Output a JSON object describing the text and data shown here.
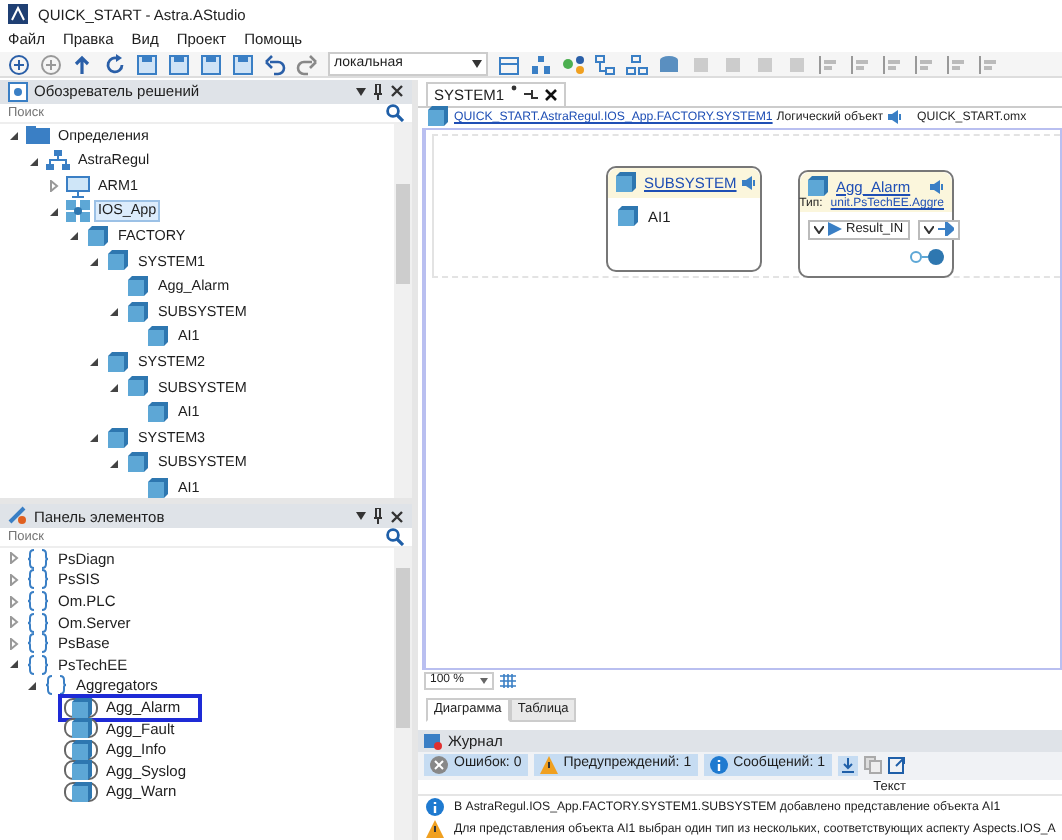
{
  "window": {
    "title": "QUICK_START - Astra.AStudio"
  },
  "menu": [
    "Файл",
    "Правка",
    "Вид",
    "Проект",
    "Помощь"
  ],
  "toolbar": {
    "dropdown": "локальная"
  },
  "solution_explorer": {
    "title": "Обозреватель решений",
    "placeholder": "Поиск",
    "tree": [
      {
        "label": "Определения",
        "kind": "folder",
        "expanded": true,
        "selected": false,
        "children": [
          {
            "label": "AstraRegul",
            "kind": "network",
            "expanded": true,
            "selected": false,
            "children": [
              {
                "label": "ARM1",
                "kind": "computer",
                "expanded": false,
                "selected": false
              },
              {
                "label": "IOS_App",
                "kind": "app",
                "expanded": true,
                "selected": true,
                "children": [
                  {
                    "label": "FACTORY",
                    "kind": "object",
                    "expanded": true,
                    "selected": false,
                    "children": [
                      {
                        "label": "SYSTEM1",
                        "kind": "object",
                        "expanded": true,
                        "selected": false,
                        "children": [
                          {
                            "label": "Agg_Alarm",
                            "kind": "object",
                            "selected": false
                          },
                          {
                            "label": "SUBSYSTEM",
                            "kind": "object",
                            "expanded": true,
                            "selected": false,
                            "children": [
                              {
                                "label": "AI1",
                                "kind": "object",
                                "selected": false
                              }
                            ]
                          }
                        ]
                      },
                      {
                        "label": "SYSTEM2",
                        "kind": "object",
                        "expanded": true,
                        "selected": false,
                        "children": [
                          {
                            "label": "SUBSYSTEM",
                            "kind": "object",
                            "expanded": true,
                            "selected": false,
                            "children": [
                              {
                                "label": "AI1",
                                "kind": "object",
                                "selected": false
                              }
                            ]
                          }
                        ]
                      },
                      {
                        "label": "SYSTEM3",
                        "kind": "object",
                        "expanded": true,
                        "selected": false,
                        "children": [
                          {
                            "label": "SUBSYSTEM",
                            "kind": "object",
                            "expanded": true,
                            "selected": false,
                            "children": [
                              {
                                "label": "AI1",
                                "kind": "object",
                                "selected": false
                              }
                            ]
                          }
                        ]
                      }
                    ]
                  }
                ]
              }
            ]
          }
        ]
      }
    ]
  },
  "toolbox": {
    "title": "Панель элементов",
    "placeholder": "Поиск",
    "tree": [
      {
        "label": "PsDiagn",
        "kind": "namespace",
        "expanded": false,
        "selected": false
      },
      {
        "label": "PsSIS",
        "kind": "namespace",
        "expanded": false,
        "selected": false
      },
      {
        "label": "Om.PLC",
        "kind": "namespace",
        "expanded": false,
        "selected": false
      },
      {
        "label": "Om.Server",
        "kind": "namespace",
        "expanded": false,
        "selected": false
      },
      {
        "label": "PsBase",
        "kind": "namespace",
        "expanded": false,
        "selected": false
      },
      {
        "label": "PsTechEE",
        "kind": "namespace",
        "expanded": true,
        "selected": false,
        "children": [
          {
            "label": "Aggregators",
            "kind": "namespace",
            "expanded": true,
            "selected": false,
            "children": [
              {
                "label": "Agg_Alarm",
                "kind": "type",
                "selected": true
              },
              {
                "label": "Agg_Fault",
                "kind": "type",
                "selected": false
              },
              {
                "label": "Agg_Info",
                "kind": "type",
                "selected": false
              },
              {
                "label": "Agg_Syslog",
                "kind": "type",
                "selected": false
              },
              {
                "label": "Agg_Warn",
                "kind": "type",
                "selected": false
              }
            ]
          }
        ]
      }
    ]
  },
  "editor": {
    "tab": {
      "label": "SYSTEM1",
      "modified": true
    },
    "breadcrumb": {
      "path": "QUICK_START.AstraRegul.IOS_App.FACTORY.SYSTEM1",
      "object_kind": "Логический объект",
      "file": "QUICK_START.omx"
    },
    "nodes": [
      {
        "kind": "container",
        "title": "SUBSYSTEM",
        "items": [
          "AI1"
        ]
      },
      {
        "kind": "instance",
        "title": "Agg_Alarm",
        "type_label": "Тип:",
        "type_link": "unit.PsTechEE.Aggre",
        "port": "Result_IN"
      }
    ],
    "zoom": "100 %",
    "view_tabs": [
      {
        "label": "Диаграмма",
        "selected": true
      },
      {
        "label": "Таблица",
        "selected": false
      }
    ]
  },
  "journal": {
    "title": "Журнал",
    "filters": [
      {
        "kind": "error",
        "label": "Ошибок: 0",
        "selected": true
      },
      {
        "kind": "warning",
        "label": "Предупреждений: 1",
        "selected": true
      },
      {
        "kind": "info",
        "label": "Сообщений: 1",
        "selected": true
      }
    ],
    "column": "Текст",
    "entries": [
      {
        "kind": "info",
        "text": "В AstraRegul.IOS_App.FACTORY.SYSTEM1.SUBSYSTEM добавлено представление объекта AI1"
      },
      {
        "kind": "warning",
        "text": "Для представления объекта AI1 выбран один тип из нескольких, соответствующих аспекту Aspects.IOS_A"
      }
    ]
  }
}
